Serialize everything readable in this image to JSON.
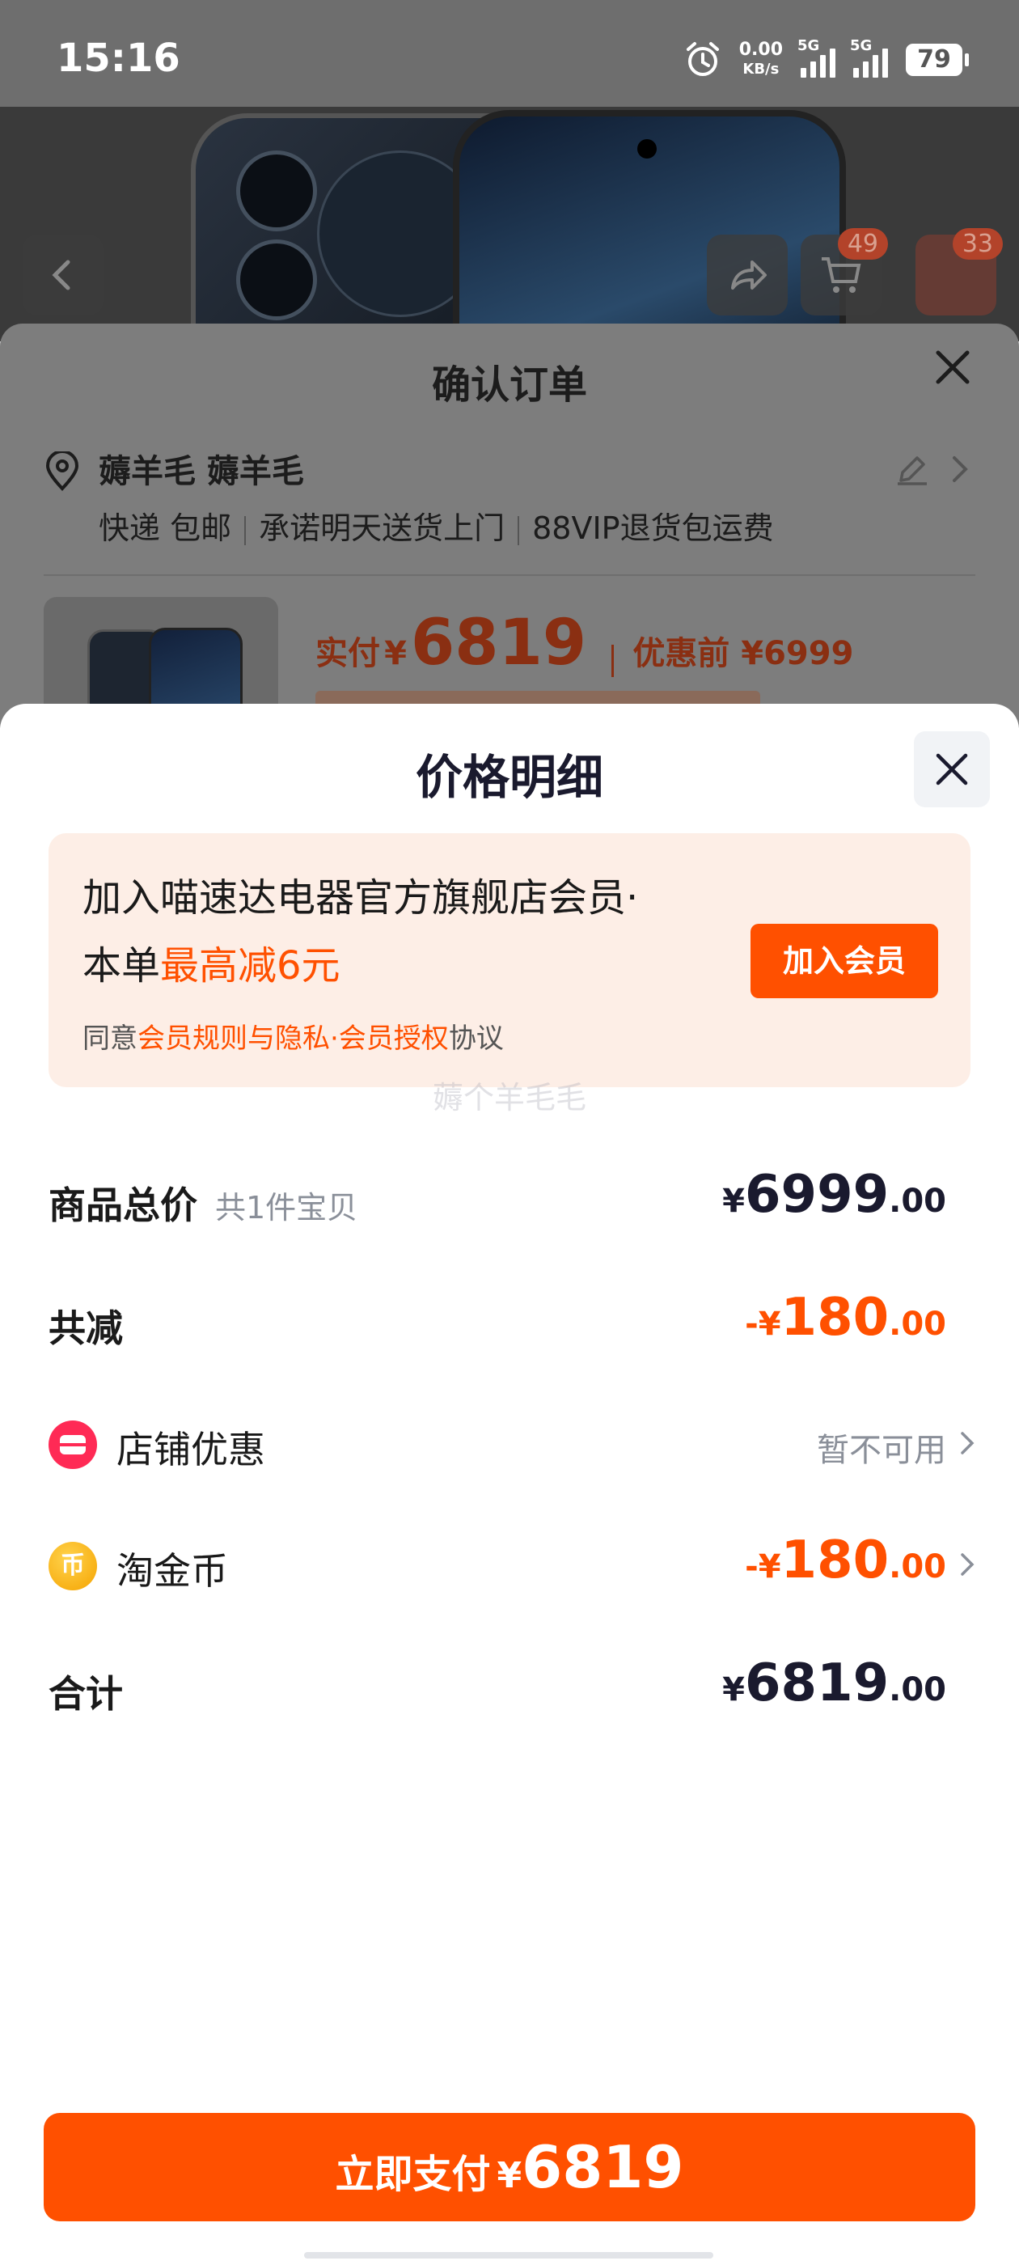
{
  "status_bar": {
    "time": "15:16",
    "net_speed": "0.00",
    "net_unit": "KB/s",
    "sim1": "5G",
    "sim2": "5G",
    "battery": "79"
  },
  "product_header": {
    "cart_badge": "49",
    "more_badge": "33"
  },
  "order_sheet": {
    "title": "确认订单",
    "address_name": "薅羊毛 薅羊毛",
    "shipping": [
      "快递 包邮",
      "承诺明天送货上门",
      "88VIP退货包运费"
    ],
    "pay_label": "实付",
    "pay_currency": "¥",
    "pay_amount": "6819",
    "before_label": "优惠前 ¥6999"
  },
  "price_detail": {
    "title": "价格明细",
    "promo": {
      "line1": "加入喵速达电器官方旗舰店会员·",
      "line2_prefix": "本单",
      "line2_highlight": "最高减6元",
      "agree_prefix": "同意",
      "agree_link": "会员规则与隐私·会员授权",
      "agree_suffix": "协议",
      "join_label": "加入会员"
    },
    "watermark": "薅个羊毛毛",
    "rows": {
      "total": {
        "label": "商品总价",
        "sub": "共1件宝贝",
        "currency": "¥",
        "int": "6999",
        "dec": ".00"
      },
      "reduction": {
        "label": "共减",
        "currency": "-¥",
        "int": "180",
        "dec": ".00"
      },
      "store_discount": {
        "label": "店铺优惠",
        "status": "暂不可用"
      },
      "tao_coin": {
        "label": "淘金币",
        "icon_text": "币",
        "currency": "-¥",
        "int": "180",
        "dec": ".00"
      },
      "sum": {
        "label": "合计",
        "currency": "¥",
        "int": "6819",
        "dec": ".00"
      }
    },
    "pay_button": {
      "label": "立即支付",
      "currency": "¥",
      "amount": "6819"
    }
  },
  "colors": {
    "accent": "#ff5000",
    "promo_bg": "#fdeee6",
    "store_icon": "#ff2a55",
    "coin": "#f5a300"
  }
}
